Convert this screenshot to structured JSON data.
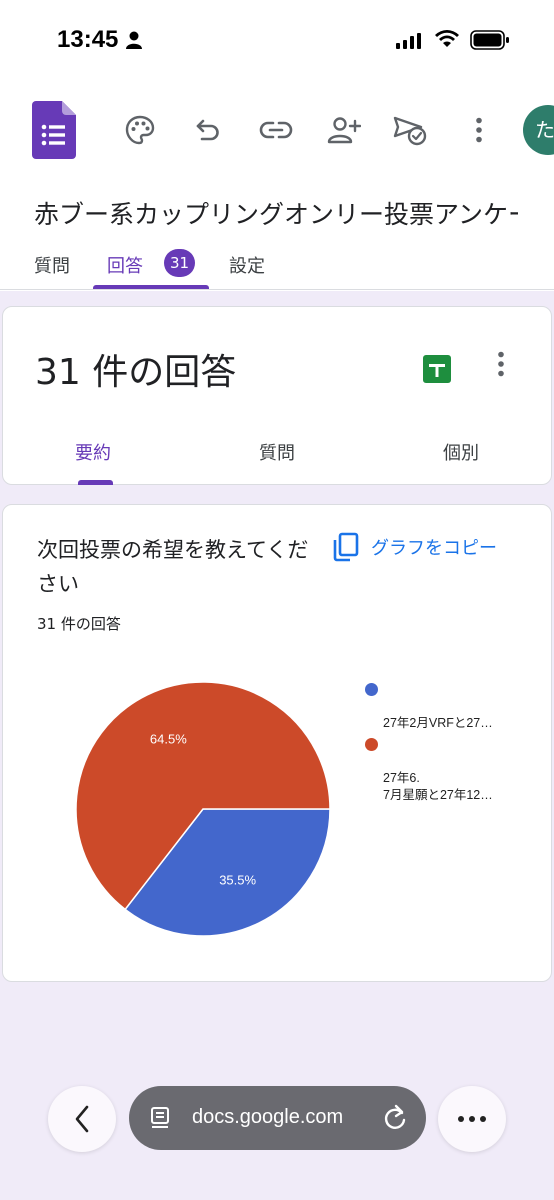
{
  "status": {
    "time": "13:45"
  },
  "toolbar": {
    "avatar_initial": "た"
  },
  "form": {
    "title": "赤ブー系カップリングオンリー投票アンケート"
  },
  "tabs": [
    {
      "label": "質問"
    },
    {
      "label": "回答",
      "badge": "31"
    },
    {
      "label": "設定"
    }
  ],
  "responses": {
    "title": "31 件の回答",
    "sub_tabs": [
      {
        "label": "要約"
      },
      {
        "label": "質問"
      },
      {
        "label": "個別"
      }
    ]
  },
  "question": {
    "title": "次回投票の希望を教えてください",
    "copy_label": "グラフをコピー",
    "count": "31 件の回答"
  },
  "chart_data": {
    "type": "pie",
    "categories": [
      "27年2月VRFと27…",
      "27年6.\n7月星願と27年12…"
    ],
    "values": [
      35.5,
      64.5
    ],
    "labels": [
      "35.5%",
      "64.5%"
    ],
    "colors": [
      "#4367cc",
      "#cc4a29"
    ],
    "legend": "right"
  },
  "browser": {
    "url": "docs.google.com"
  }
}
